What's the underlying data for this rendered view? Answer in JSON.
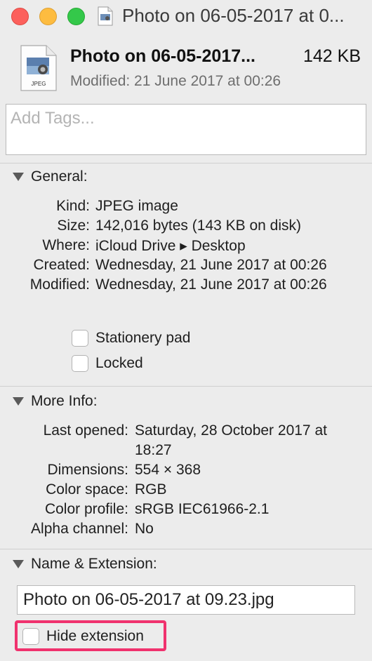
{
  "window": {
    "title": "Photo on 06-05-2017 at 0..."
  },
  "header": {
    "file_name": "Photo on 06-05-2017...",
    "file_size": "142 KB",
    "modified": "Modified: 21 June 2017 at 00:26",
    "file_icon_label": "JPEG"
  },
  "tags": {
    "placeholder": "Add Tags..."
  },
  "general": {
    "title": "General:",
    "rows": [
      {
        "label": "Kind:",
        "value": "JPEG image"
      },
      {
        "label": "Size:",
        "value": "142,016 bytes (143 KB on disk)"
      },
      {
        "label": "Where:",
        "value": "iCloud Drive ▸ Desktop"
      },
      {
        "label": "Created:",
        "value": "Wednesday, 21 June 2017 at 00:26"
      },
      {
        "label": "Modified:",
        "value": "Wednesday, 21 June 2017 at 00:26"
      }
    ],
    "stationery_label": "Stationery pad",
    "locked_label": "Locked"
  },
  "more_info": {
    "title": "More Info:",
    "rows": [
      {
        "label": "Last opened:",
        "value": "Saturday, 28 October 2017 at",
        "value2": "18:27"
      },
      {
        "label": "Dimensions:",
        "value": "554 × 368"
      },
      {
        "label": "Color space:",
        "value": "RGB"
      },
      {
        "label": "Color profile:",
        "value": "sRGB IEC61966-2.1"
      },
      {
        "label": "Alpha channel:",
        "value": "No"
      }
    ]
  },
  "name_extension": {
    "title": "Name & Extension:",
    "file_name_value": "Photo on 06-05-2017 at 09.23.jpg",
    "hide_extension_label": "Hide extension",
    "highlight_color": "#f0326e"
  },
  "icons": {
    "close": "close-icon",
    "minimize": "minimize-icon",
    "zoom": "zoom-icon",
    "document": "jpeg-document-icon"
  }
}
